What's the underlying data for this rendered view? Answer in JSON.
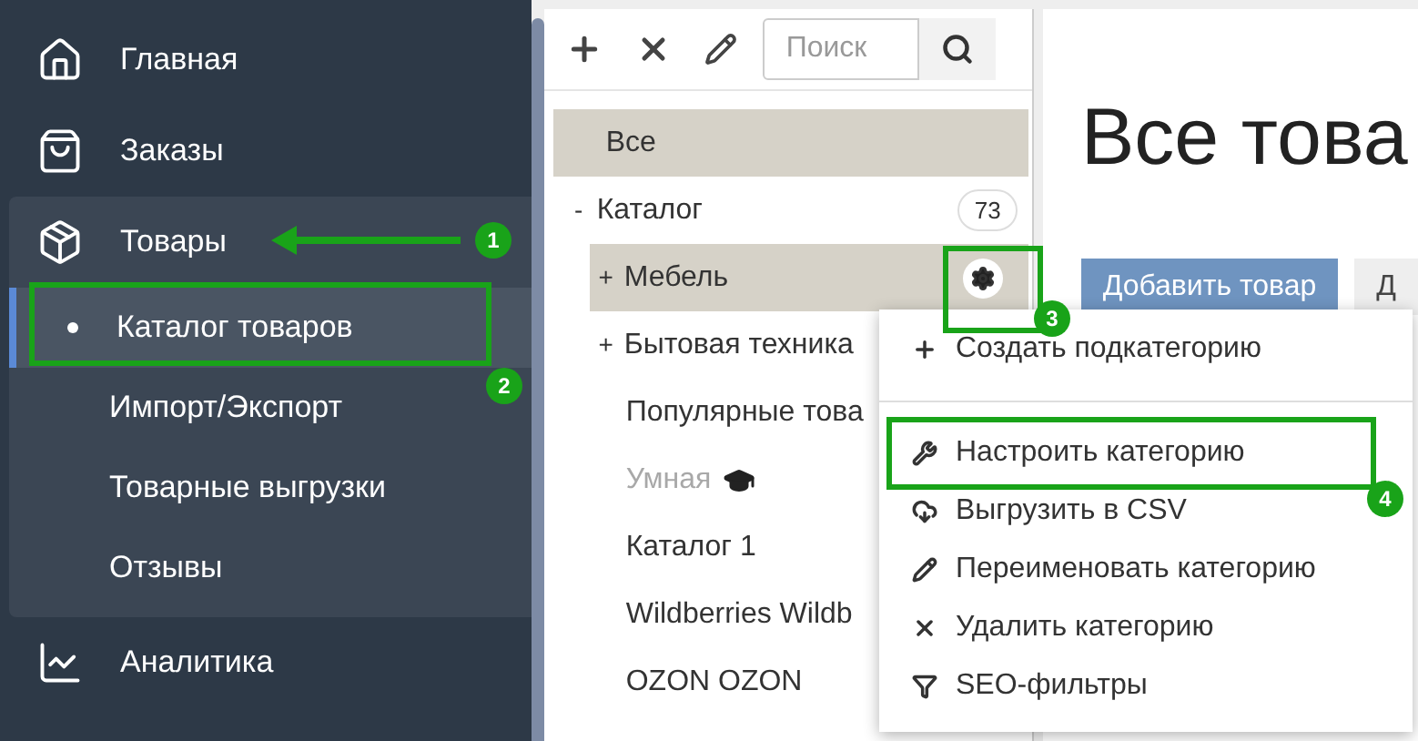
{
  "sidebar": {
    "items": [
      {
        "label": "Главная"
      },
      {
        "label": "Заказы"
      },
      {
        "label": "Товары",
        "children": [
          {
            "label": "Каталог товаров",
            "selected": true
          },
          {
            "label": "Импорт/Экспорт",
            "selected": false
          },
          {
            "label": "Товарные выгрузки",
            "selected": false
          },
          {
            "label": "Отзывы",
            "selected": false
          }
        ]
      },
      {
        "label": "Аналитика"
      }
    ]
  },
  "toolbar": {
    "search": {
      "placeholder": "Поиск"
    }
  },
  "tree": [
    {
      "label": "Все",
      "kind": "leaf",
      "selected": true,
      "disabled": false
    },
    {
      "label": "Каталог",
      "kind": "group",
      "toggle": "-",
      "selected": false,
      "disabled": false,
      "count": "73",
      "children": [
        {
          "label": "Мебель",
          "kind": "group",
          "toggle": "+",
          "selected": true,
          "disabled": false
        },
        {
          "label": "Бытовая техника",
          "kind": "group",
          "toggle": "+",
          "selected": false,
          "disabled": false
        },
        {
          "label": "Популярные това",
          "kind": "leaf",
          "selected": false,
          "disabled": false
        },
        {
          "label": "Умная",
          "kind": "smart",
          "selected": false,
          "disabled": true
        },
        {
          "label": "Каталог 1",
          "kind": "leaf",
          "selected": false,
          "disabled": false
        },
        {
          "label": "Wildberries Wildb",
          "kind": "leaf",
          "selected": false,
          "disabled": false
        },
        {
          "label": "OZON OZON",
          "kind": "leaf",
          "selected": false,
          "disabled": false
        }
      ]
    }
  ],
  "content": {
    "title": "Все това",
    "buttons": [
      {
        "label": "Добавить товар",
        "kind": "primary"
      },
      {
        "label": "Д",
        "kind": "secondary"
      }
    ]
  },
  "context_menu": {
    "items": [
      {
        "label": "Создать подкатегорию"
      },
      {
        "label": "Настроить категорию"
      },
      {
        "label": "Выгрузить в CSV"
      },
      {
        "label": "Переименовать категорию"
      },
      {
        "label": "Удалить категорию"
      },
      {
        "label": "SEO-фильтры"
      }
    ]
  },
  "annotations": [
    "1",
    "2",
    "3",
    "4"
  ]
}
